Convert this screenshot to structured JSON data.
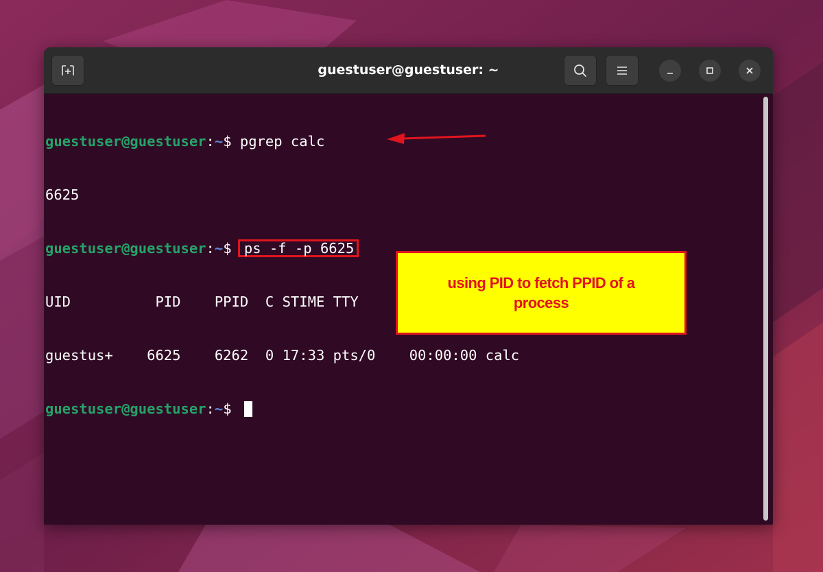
{
  "window": {
    "title": "guestuser@guestuser: ~",
    "buttons": {
      "new_tab_icon": "new-tab-icon",
      "search_icon": "search-icon",
      "menu_icon": "hamburger-menu-icon",
      "minimize_icon": "minimize-icon",
      "maximize_icon": "maximize-icon",
      "close_icon": "close-icon"
    }
  },
  "terminal": {
    "prompt_user": "guestuser@guestuser",
    "prompt_sep": ":",
    "prompt_path": "~",
    "prompt_symbol": "$ ",
    "lines": [
      {
        "command": "pgrep calc"
      },
      {
        "output": "6625"
      },
      {
        "command": "ps -f -p 6625"
      },
      {
        "output": "UID          PID    PPID  C STIME TTY          TIME CMD"
      },
      {
        "output": "guestus+    6625    6262  0 17:33 pts/0    00:00:00 calc"
      }
    ]
  },
  "annotation": {
    "text": "using PID to fetch PPID of a process"
  },
  "colors": {
    "terminal_bg": "#300a24",
    "prompt_user": "#26a269",
    "prompt_path": "#5f87d7",
    "highlight": "#e0151f",
    "annotation_bg": "#ffff00"
  }
}
